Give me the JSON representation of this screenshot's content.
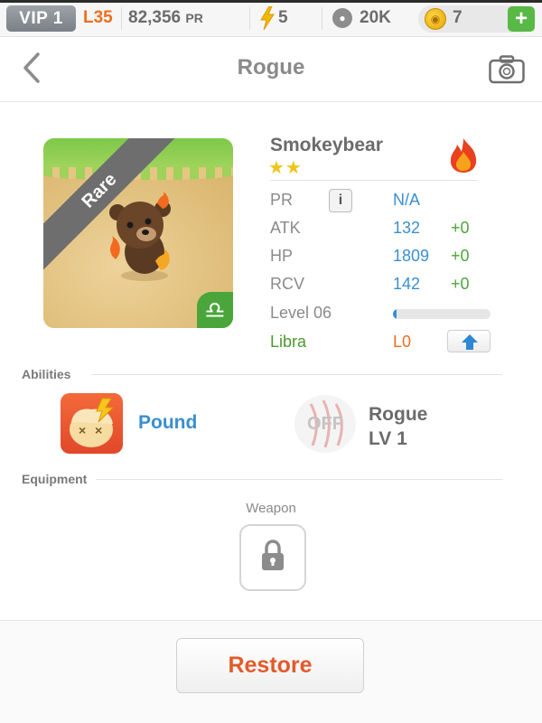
{
  "topbar": {
    "vip": "VIP 1",
    "level": "L35",
    "pr_value": "82,356",
    "pr_unit": "PR",
    "energy": "5",
    "paws": "20K",
    "coins": "7"
  },
  "header": {
    "title": "Rogue"
  },
  "pet": {
    "rarity": "Rare",
    "name": "Smokeybear",
    "stars": "★★",
    "stats": [
      {
        "label": "PR",
        "value": "N/A",
        "bonus": ""
      },
      {
        "label": "ATK",
        "value": "132",
        "bonus": "+0"
      },
      {
        "label": "HP",
        "value": "1809",
        "bonus": "+0"
      },
      {
        "label": "RCV",
        "value": "142",
        "bonus": "+0"
      }
    ],
    "level_label": "Level 06",
    "level_progress": 0.02,
    "zodiac": "Libra",
    "zodiac_level": "L0",
    "zodiac_symbol": "♎"
  },
  "abilities": {
    "title": "Abilities",
    "ability_name": "Pound",
    "skill_status": "OFF",
    "skill_name": "Rogue",
    "skill_level": "LV 1"
  },
  "equipment": {
    "title": "Equipment",
    "weapon_label": "Weapon"
  },
  "footer": {
    "restore_label": "Restore"
  },
  "colors": {
    "accent_blue": "#3a8fd0",
    "bonus_green": "#4ca63a",
    "orange": "#ef6d1f",
    "restore_red": "#e35a2a"
  }
}
